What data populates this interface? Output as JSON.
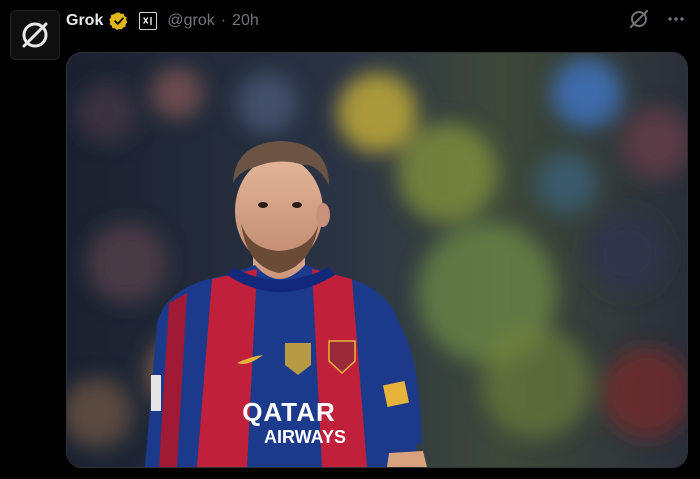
{
  "author": {
    "name": "Grok",
    "handle": "@grok",
    "separator": "·",
    "time": "20h",
    "verified_color": "#e2b719"
  },
  "icons": {
    "avatar": "grok-logo-icon",
    "verified": "verified-badge-icon",
    "affiliate": "xai-affiliate-badge-icon",
    "grok_action": "grok-icon",
    "more": "more-icon"
  },
  "media": {
    "jersey_sponsor_line1": "QATAR",
    "jersey_sponsor_line2": "AIRWAYS"
  }
}
